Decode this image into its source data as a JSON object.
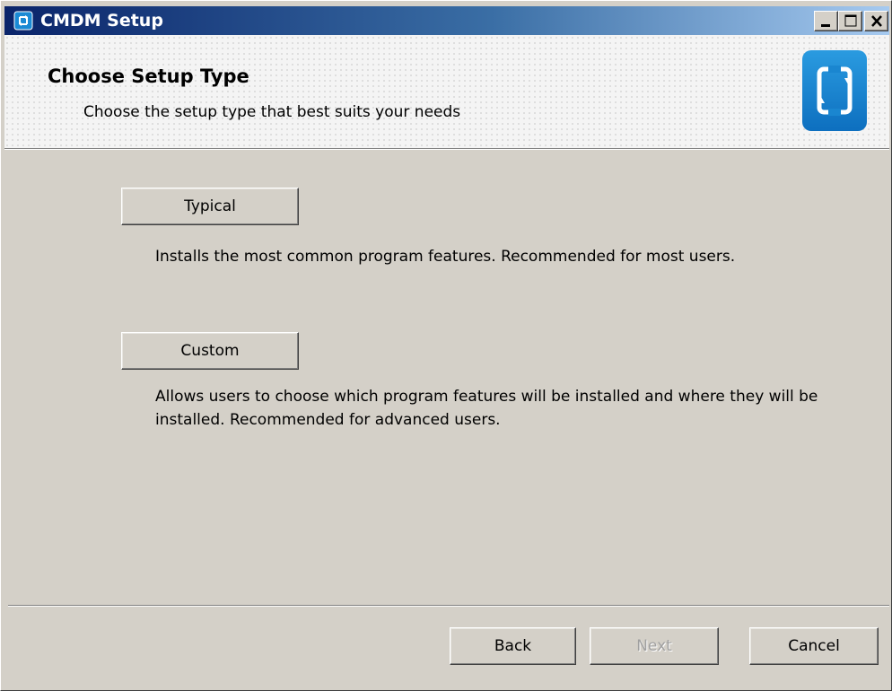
{
  "window": {
    "title": "CMDM Setup",
    "controls": {
      "minimize_icon": "minimize-icon",
      "maximize_icon": "maximize-icon",
      "close_icon": "close-icon"
    },
    "app_icon": "cmdm-app-icon"
  },
  "banner": {
    "title": "Choose Setup Type",
    "subtitle": "Choose the setup type that best suits your needs",
    "logo_icon": "device-rotate-icon",
    "logo_color": "#1a8ad4"
  },
  "options": {
    "typical": {
      "label": "Typical",
      "description": "Installs the most common program features. Recommended for most users."
    },
    "custom": {
      "label": "Custom",
      "description": "Allows users to choose which program features will be installed and where they will be installed. Recommended for advanced users."
    }
  },
  "footer": {
    "back_label": "Back",
    "next_label": "Next",
    "next_enabled": false,
    "cancel_label": "Cancel"
  },
  "colors": {
    "dialog_bg": "#d4d0c8",
    "titlebar_start": "#0a246a",
    "titlebar_end": "#a6caf0"
  }
}
